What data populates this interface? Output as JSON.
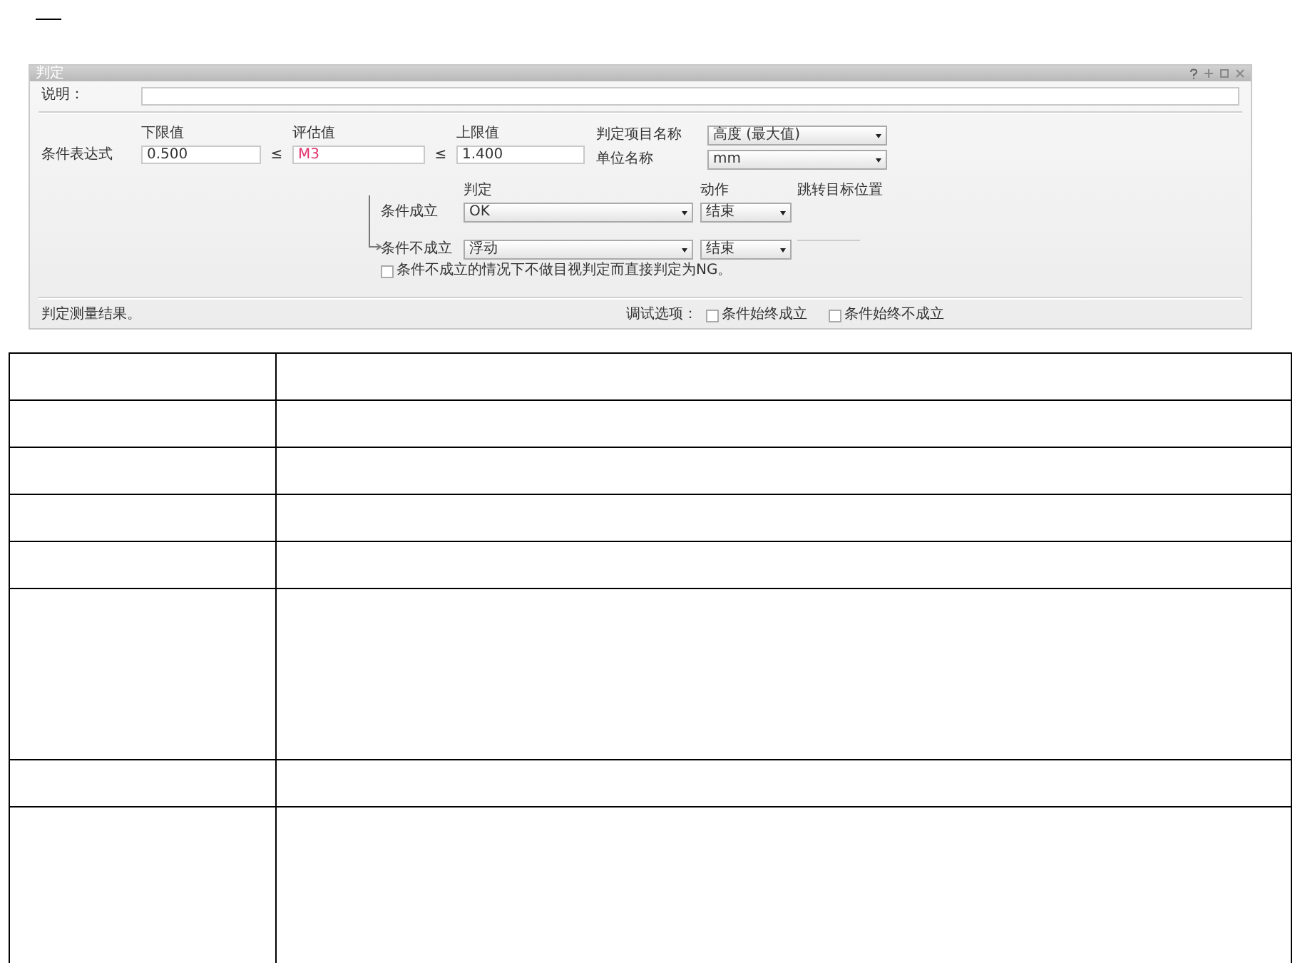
{
  "dialog": {
    "title": "判定",
    "description": {
      "label": "说明："
    },
    "expression": {
      "label": "条件表达式",
      "lower": {
        "label": "下限值",
        "value": "0.500"
      },
      "op1": "≤",
      "eval": {
        "label": "评估值",
        "value": "M3"
      },
      "op2": "≤",
      "upper": {
        "label": "上限值",
        "value": "1.400"
      },
      "item_name": {
        "label": "判定项目名称",
        "value": "高度 (最大值)"
      },
      "unit": {
        "label": "单位名称",
        "value": "mm"
      }
    },
    "branch": {
      "headers": [
        "判定",
        "动作",
        "跳转目标位置"
      ],
      "rows": [
        {
          "label": "条件成立",
          "judgement": "OK",
          "action": "结束"
        },
        {
          "label": "条件不成立",
          "judgement": "浮动",
          "action": "结束"
        }
      ],
      "direct_ng": {
        "label": "条件不成立的情况下不做目视判定而直接判定为NG。",
        "checked": false
      }
    },
    "status": "判定测量结果。",
    "debug": {
      "label": "调试选项：",
      "options": [
        {
          "label": "条件始终成立",
          "checked": false
        },
        {
          "label": "条件始终不成立",
          "checked": false
        }
      ]
    }
  },
  "table": {
    "rows": [
      {
        "kind": "short"
      },
      {
        "kind": "short"
      },
      {
        "kind": "short"
      },
      {
        "kind": "short"
      },
      {
        "kind": "short"
      },
      {
        "kind": "tall"
      },
      {
        "kind": "short"
      },
      {
        "kind": "tall"
      }
    ]
  }
}
